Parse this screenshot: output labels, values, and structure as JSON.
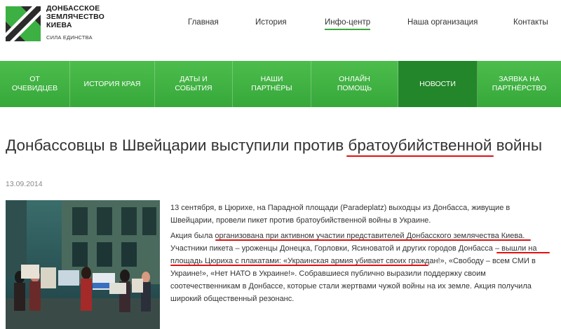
{
  "brand": {
    "line1": "ДОНБАССКОЕ",
    "line2": "ЗЕМЛЯЧЕСТВО",
    "line3": "КИЕВА",
    "slogan": "СИЛА ЕДИНСТВА",
    "colors": {
      "mark_dark": "#2b2b2b",
      "mark_green": "#3cb043"
    }
  },
  "topnav": {
    "items": [
      {
        "label": "Главная"
      },
      {
        "label": "История"
      },
      {
        "label": "Инфо-центр",
        "active": true
      },
      {
        "label": "Наша организация"
      },
      {
        "label": "Контакты"
      }
    ]
  },
  "band": {
    "color": "#3cb043",
    "active_color": "#23862a",
    "items": [
      {
        "line1": "ОТ",
        "line2": "ОЧЕВИДЦЕВ"
      },
      {
        "line1": "ИСТОРИЯ КРАЯ",
        "line2": ""
      },
      {
        "line1": "ДАТЫ И",
        "line2": "СОБЫТИЯ"
      },
      {
        "line1": "НАШИ",
        "line2": "ПАРТНЁРЫ"
      },
      {
        "line1": "ОНЛАЙН",
        "line2": "ПОМОЩЬ"
      },
      {
        "line1": "НОВОСТИ",
        "line2": "",
        "active": true
      },
      {
        "line1": "ЗАЯВКА НА",
        "line2": "ПАРТНЁРСТВО"
      }
    ]
  },
  "article": {
    "title": "Донбассовцы в Швейцарии выступили против братоубийственной войны",
    "date": "13.09.2014",
    "p1": [
      "13 сентября, в Цюрихе, на Парадной площади (Paradeplatz) выходцы из Донбасса, живущие в",
      "Швейцарии, провели пикет против братоубийственной войны в Украине."
    ],
    "p2": [
      "Акция была организована при активном участии представителей Донбасского землячества Киева.",
      "Участники пикета – уроженцы Донецка, Горловки, Ясиноватой и других городов Донбасса – вышли на",
      "площадь Цюриха с плакатами: «Украинская армия убивает своих граждан!», «Свободу – всем СМИ в",
      "Украине!», «Нет НАТО в Украине!». Собравшиеся публично выразили поддержку своим",
      "соотечественникам в Донбассе, которые стали жертвами чужой войны на их земле. Акция получила",
      "широкий общественный резонанс."
    ],
    "highlight_color": "#e01010"
  }
}
